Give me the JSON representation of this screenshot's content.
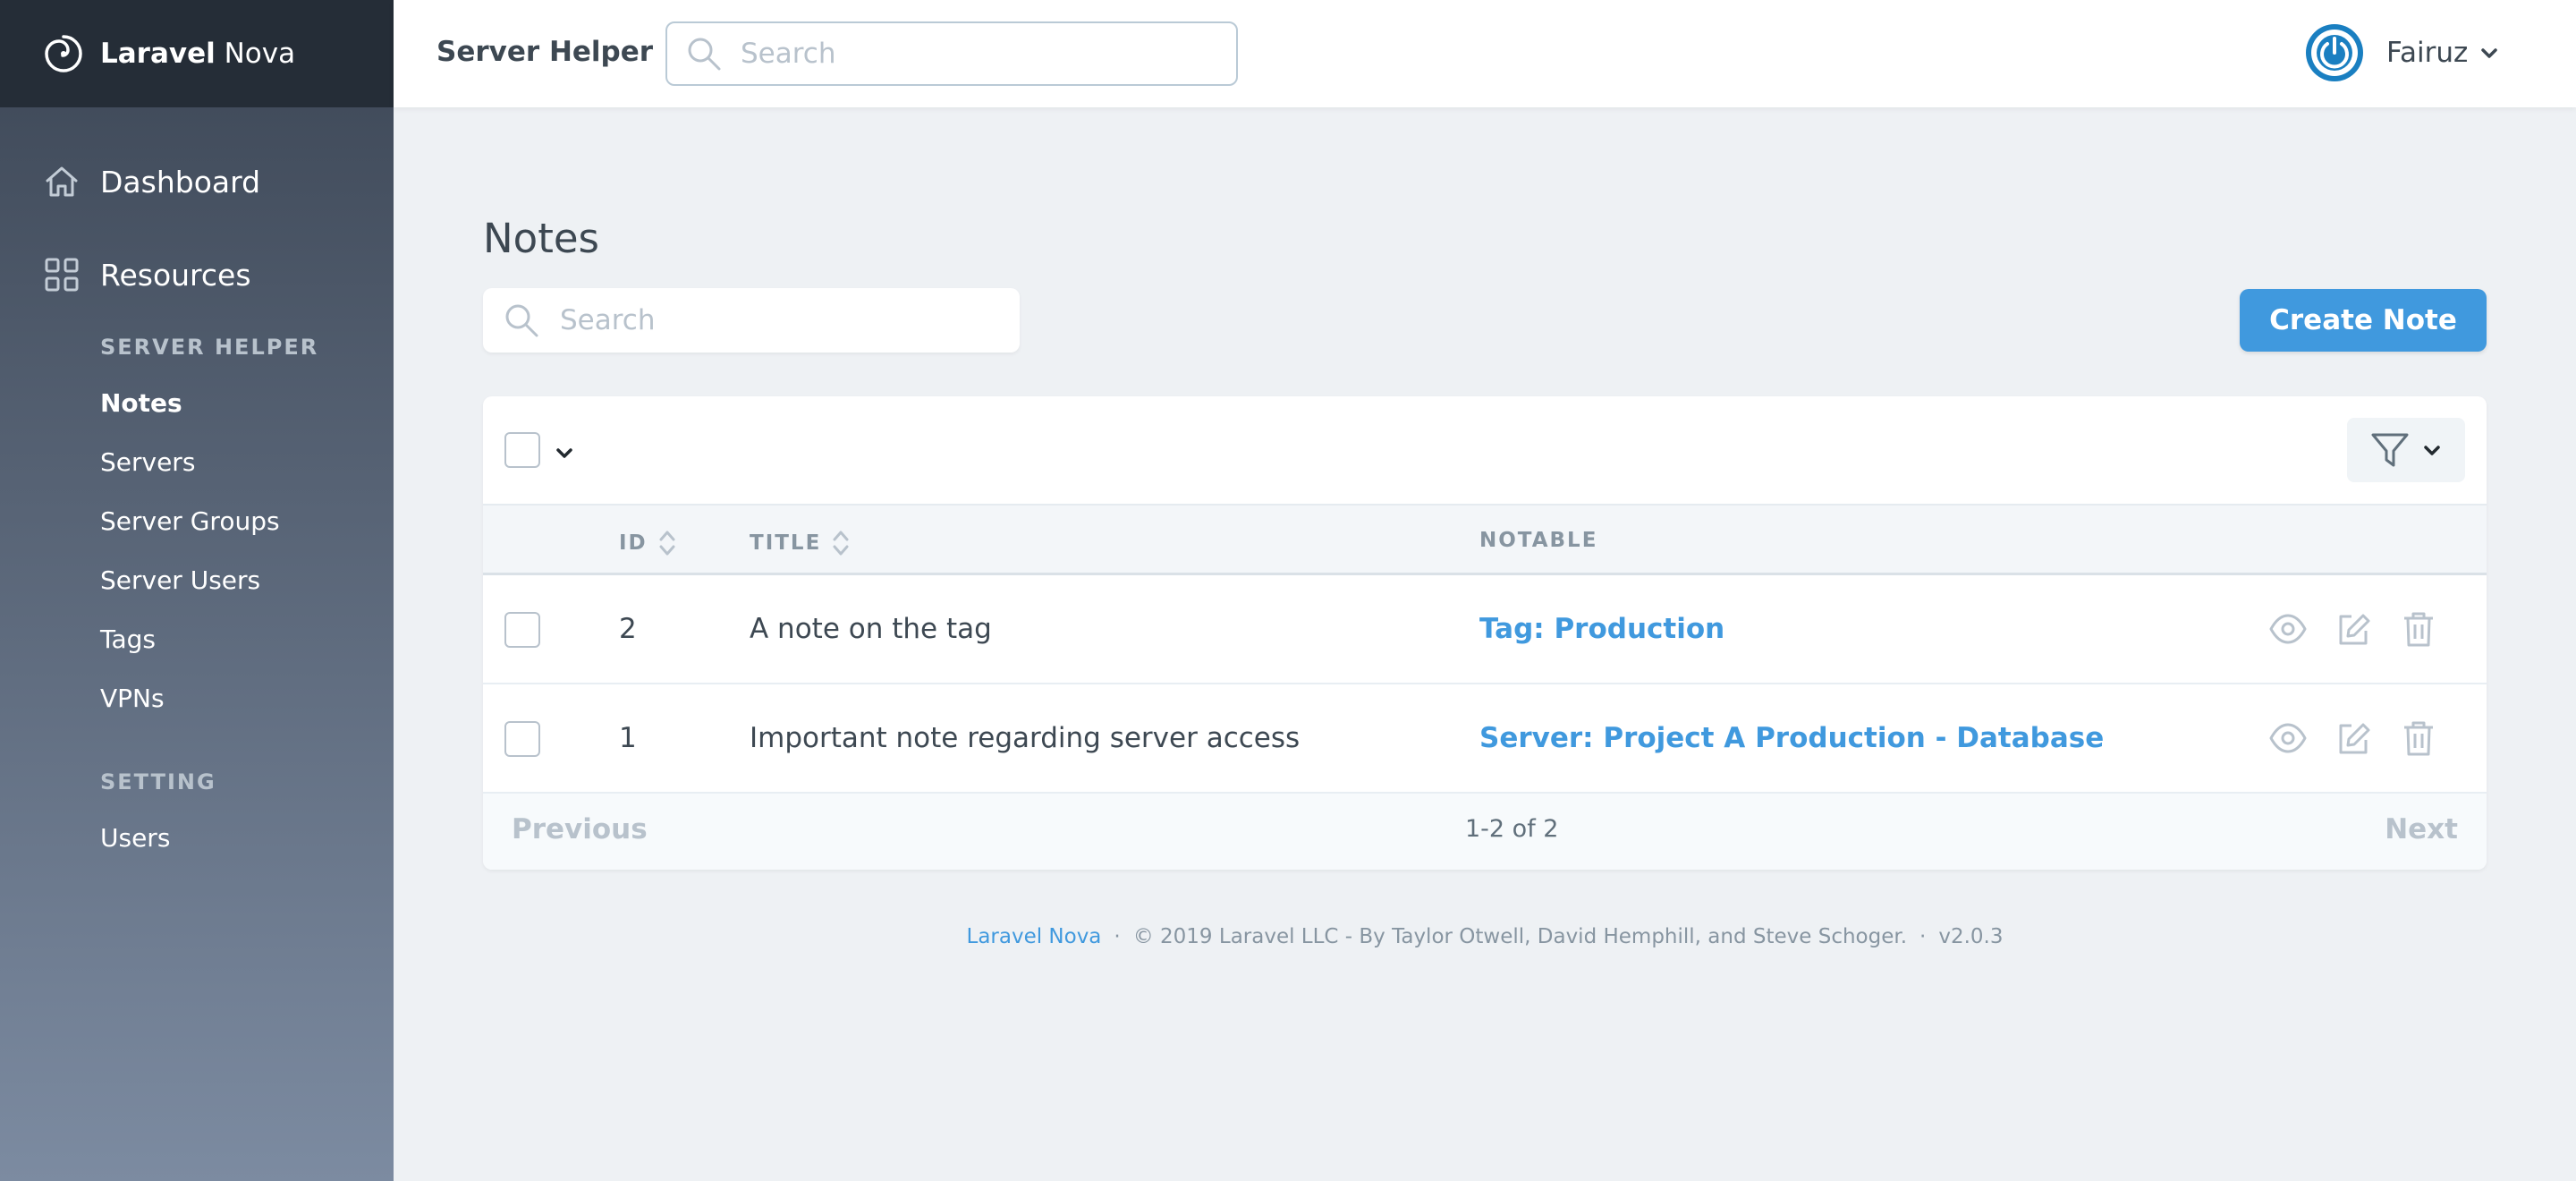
{
  "brand": {
    "bold": "Laravel",
    "rest": " Nova"
  },
  "sidebar": {
    "top_items": [
      {
        "label": "Dashboard",
        "icon": "home-icon"
      },
      {
        "label": "Resources",
        "icon": "grid-icon"
      }
    ],
    "sections": [
      {
        "title": "SERVER HELPER",
        "items": [
          "Notes",
          "Servers",
          "Server Groups",
          "Server Users",
          "Tags",
          "VPNs"
        ]
      },
      {
        "title": "SETTING",
        "items": [
          "Users"
        ]
      }
    ],
    "active_item": "Notes"
  },
  "header": {
    "app_name": "Server Helper",
    "search_placeholder": "Search",
    "user_name": "Fairuz"
  },
  "main": {
    "title": "Notes",
    "search_placeholder": "Search",
    "create_label": "Create Note"
  },
  "table": {
    "columns": {
      "id": "ID",
      "title": "TITLE",
      "notable": "NOTABLE"
    },
    "rows": [
      {
        "id": "2",
        "title": "A note on the tag",
        "notable": "Tag: Production"
      },
      {
        "id": "1",
        "title": "Important note regarding server access",
        "notable": "Server: Project A Production - Database"
      }
    ]
  },
  "pagination": {
    "previous": "Previous",
    "info": "1-2 of 2",
    "next": "Next"
  },
  "footer": {
    "link": "Laravel Nova",
    "sep": "·",
    "copyright": "© 2019 Laravel LLC - By Taylor Otwell, David Hemphill, and Steve Schoger.",
    "version": "v2.0.3"
  },
  "colors": {
    "accent": "#4099de",
    "sidebar_top": "#3c4655",
    "sidebar_bottom": "#7c8ba1",
    "brand_bar": "#252d37"
  }
}
